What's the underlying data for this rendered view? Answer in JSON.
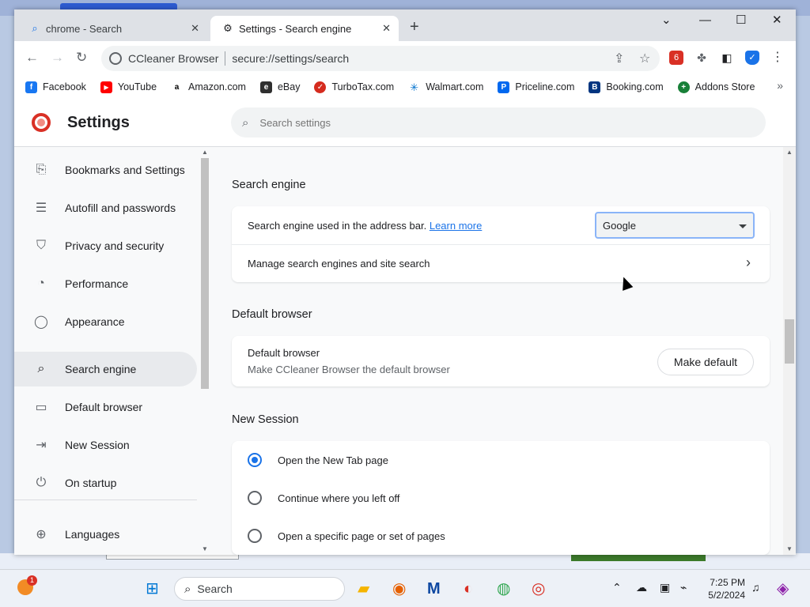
{
  "tabs": [
    {
      "title": "chrome - Search",
      "icon": "search-icon"
    },
    {
      "title": "Settings - Search engine",
      "icon": "gear-icon"
    }
  ],
  "omnibox": {
    "site": "CCleaner Browser",
    "url": "secure://settings/search"
  },
  "extensions": [
    {
      "name": "extension-badge-icon",
      "label": "6",
      "color": "#d93025"
    },
    {
      "name": "puzzle-icon",
      "label": ""
    },
    {
      "name": "side-panel-icon",
      "label": ""
    },
    {
      "name": "shield-icon",
      "label": "✓",
      "color": "#1a73e8"
    }
  ],
  "bookmarks": [
    {
      "label": "Facebook",
      "color": "#1877f2",
      "glyph": "f"
    },
    {
      "label": "YouTube",
      "color": "#ff0000",
      "glyph": "▶"
    },
    {
      "label": "Amazon.com",
      "color": "#000000",
      "glyph": "a"
    },
    {
      "label": "eBay",
      "color": "#2f2f2f",
      "glyph": "e"
    },
    {
      "label": "TurboTax.com",
      "color": "#d52b1e",
      "glyph": "✓"
    },
    {
      "label": "Walmart.com",
      "color": "#0071ce",
      "glyph": "✳"
    },
    {
      "label": "Priceline.com",
      "color": "#0068ef",
      "glyph": "P"
    },
    {
      "label": "Booking.com",
      "color": "#003580",
      "glyph": "B"
    },
    {
      "label": "Addons Store",
      "color": "#188038",
      "glyph": "+"
    }
  ],
  "settings": {
    "title": "Settings",
    "search_placeholder": "Search settings"
  },
  "sidebar": {
    "items": [
      {
        "label": "Bookmarks and Settings",
        "icon": "bookmark-icon",
        "glyph": "⎘"
      },
      {
        "label": "Autofill and passwords",
        "icon": "autofill-icon",
        "glyph": "☰"
      },
      {
        "label": "Privacy and security",
        "icon": "shield-icon",
        "glyph": "⛉"
      },
      {
        "label": "Performance",
        "icon": "gauge-icon",
        "glyph": "◔"
      },
      {
        "label": "Appearance",
        "icon": "palette-icon",
        "glyph": "◯"
      },
      {
        "label": "Search engine",
        "icon": "search-icon",
        "glyph": "⌕",
        "active": true
      },
      {
        "label": "Default browser",
        "icon": "browser-icon",
        "glyph": "▭"
      },
      {
        "label": "New Session",
        "icon": "new-session-icon",
        "glyph": "⇥"
      },
      {
        "label": "On startup",
        "icon": "power-icon",
        "glyph": "⏻"
      },
      {
        "label": "Languages",
        "icon": "globe-icon",
        "glyph": "⊕"
      }
    ]
  },
  "search_engine": {
    "section_title": "Search engine",
    "row1_text": "Search engine used in the address bar.",
    "row1_link": "Learn more",
    "selected_engine": "Google",
    "row2_text": "Manage search engines and site search"
  },
  "default_browser": {
    "section_title": "Default browser",
    "title": "Default browser",
    "subtitle": "Make CCleaner Browser the default browser",
    "button": "Make default"
  },
  "new_session": {
    "section_title": "New Session",
    "options": [
      {
        "label": "Open the New Tab page",
        "checked": true
      },
      {
        "label": "Continue where you left off",
        "checked": false
      },
      {
        "label": "Open a specific page or set of pages",
        "checked": false
      }
    ]
  },
  "taskbar": {
    "search_label": "Search",
    "notification_count": "1",
    "time": "7:25 PM",
    "date": "5/2/2024"
  }
}
